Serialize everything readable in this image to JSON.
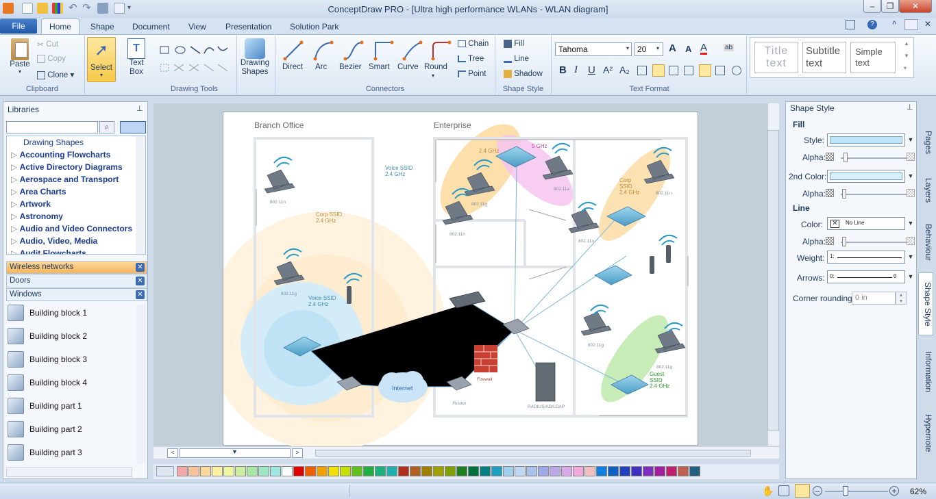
{
  "window": {
    "title": "ConceptDraw PRO - [Ultra high performance WLANs - WLAN diagram]"
  },
  "menu": {
    "file": "File",
    "tabs": [
      "Home",
      "Shape",
      "Document",
      "View",
      "Presentation",
      "Solution Park"
    ]
  },
  "ribbon": {
    "clipboard": {
      "label": "Clipboard",
      "paste": "Paste",
      "cut": "Cut",
      "copy": "Copy",
      "clone": "Clone"
    },
    "select": {
      "label": "Select"
    },
    "textbox": {
      "label": "Text\nBox"
    },
    "drawing_tools": {
      "label": "Drawing Tools"
    },
    "drawing_shapes": {
      "label": "Drawing\nShapes"
    },
    "connectors": {
      "label": "Connectors",
      "items": [
        "Direct",
        "Arc",
        "Bezier",
        "Smart",
        "Curve",
        "Round"
      ],
      "chain": "Chain",
      "tree": "Tree",
      "point": "Point"
    },
    "shape_style": {
      "label": "Shape Style",
      "fill": "Fill",
      "line": "Line",
      "shadow": "Shadow"
    },
    "text_format": {
      "label": "Text Format",
      "font": "Tahoma",
      "size": "20"
    },
    "styles": {
      "title": "Title\ntext",
      "subtitle": "Subtitle\ntext",
      "simple": "Simple\ntext"
    }
  },
  "libraries": {
    "title": "Libraries",
    "tree": [
      "Drawing Shapes",
      "Accounting Flowcharts",
      "Active Directory Diagrams",
      "Aerospace and Transport",
      "Area Charts",
      "Artwork",
      "Astronomy",
      "Audio and Video Connectors",
      "Audio, Video, Media",
      "Audit Flowcharts"
    ],
    "open_libs": [
      "Wireless networks",
      "Doors",
      "Windows"
    ],
    "items": [
      "Building block 1",
      "Building block 2",
      "Building block 3",
      "Building block 4",
      "Building part 1",
      "Building part 2",
      "Building part 3"
    ]
  },
  "diagram": {
    "branch_office": "Branch Office",
    "enterprise": "Enterprise",
    "labels": {
      "voice_ssid_1": "Voice SSID\n2.4 GHz",
      "corp_ssid_1": "Corp SSID\n2.4 GHz",
      "voice_ssid_2": "Voice SSID\n2.4 GHz",
      "ghz_24": "2.4 GHz",
      "ghz_5": "5 GHz",
      "corp_ssid_2": "Corp\nSSID\n2.4 GHz",
      "guest_ssid": "Guest\nSSID\n2.4 GHz",
      "internet": "Internet",
      "router": "Router",
      "firewall": "Firewall",
      "radius": "RADIUS/AD/LDAP",
      "l_80211n_a": "802.11n",
      "l_80211g_a": "802.11g",
      "l_80211g_b": "802.11g",
      "l_80211a_a": "802.11a",
      "l_80211n_b": "802.11n",
      "l_80211n_c": "802.11n",
      "l_80211n_d": "802.11n",
      "l_80211g_c": "802.11g",
      "l_80211g_d": "802.11g"
    }
  },
  "shape_style": {
    "title": "Shape Style",
    "fill": "Fill",
    "style": "Style:",
    "alpha": "Alpha:",
    "second_color": "2nd Color:",
    "alpha2": "Alpha:",
    "line": "Line",
    "color": "Color:",
    "no_line": "No Line",
    "alpha3": "Alpha:",
    "weight": "Weight:",
    "weight_val": "1:",
    "arrows": "Arrows:",
    "arrows_val": "0:",
    "arrows_val_r": "0",
    "corner": "Corner rounding:",
    "corner_val": "0 in",
    "fill_color": "#bfe6fb",
    "second_fill_color": "#d8f0fc"
  },
  "side_tabs": [
    "Pages",
    "Layers",
    "Behaviour",
    "Shape Style",
    "Information",
    "Hypernote"
  ],
  "status": {
    "zoom": "62%"
  },
  "palette": [
    "#f4a7a7",
    "#f9c39a",
    "#fbd99a",
    "#fbf1a0",
    "#eef6a0",
    "#cdeea0",
    "#a8e6a4",
    "#9ee6c4",
    "#9ee6e2",
    "#ffffff",
    "#e00000",
    "#f06000",
    "#f0a000",
    "#f0e000",
    "#c8e000",
    "#60c020",
    "#20b040",
    "#20b080",
    "#20b0b0",
    "#b03020",
    "#b06020",
    "#a08000",
    "#a0a000",
    "#80a000",
    "#208020",
    "#007040",
    "#008080",
    "#20a0c0",
    "#a0d0f0",
    "#c0d8f0",
    "#a8c0e8",
    "#a0a8e8",
    "#b8a8e8",
    "#d8a8e8",
    "#f0a8d8",
    "#f0c0c0",
    "#1080e0",
    "#1060c0",
    "#2040c0",
    "#4030c0",
    "#8030c0",
    "#a020a0",
    "#c02070",
    "#c06050",
    "#206080"
  ]
}
